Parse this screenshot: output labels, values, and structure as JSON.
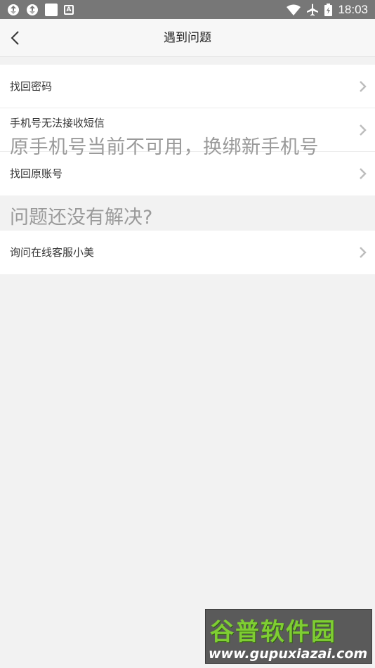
{
  "status_bar": {
    "time": "18:03",
    "notification_icons": [
      "sync-icon",
      "sync-icon",
      "square-app-icon",
      "a-app-icon"
    ],
    "a_label": "A",
    "right_icons": [
      "wifi-icon",
      "airplane-mode-icon",
      "battery-icon"
    ]
  },
  "header": {
    "back_icon": "chevron-left-icon",
    "title": "遇到问题"
  },
  "menu": {
    "items": [
      {
        "label": "找回密码",
        "icon": "chevron-right-icon"
      },
      {
        "label": "手机号无法接收短信",
        "icon": "chevron-right-icon"
      },
      {
        "label": "找回原账号",
        "icon": "chevron-right-icon"
      }
    ],
    "overlay_text": "原手机号当前不可用，换绑新手机号"
  },
  "section": {
    "heading": "问题还没有解决?"
  },
  "support": {
    "items": [
      {
        "label": "询问在线客服小美",
        "icon": "chevron-right-icon"
      }
    ]
  },
  "watermark": {
    "logo_text": "谷普软件园",
    "url": "www.gupuxiazai.com"
  },
  "colors": {
    "status_bar": "#777777",
    "background": "#f2f2f2",
    "header": "#f7f7f7",
    "row": "#ffffff",
    "muted_text": "#9a9a9a",
    "watermark_green": "#7fcd33"
  }
}
